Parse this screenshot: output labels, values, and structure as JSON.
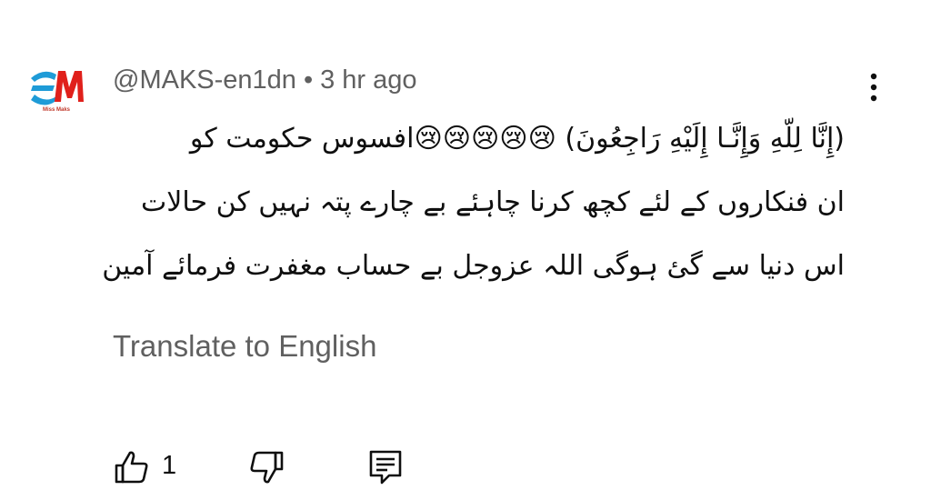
{
  "comment": {
    "author": "@MAKS-en1dn",
    "separator": "•",
    "time": "3 hr ago",
    "avatar": {
      "monogram": "M",
      "caption": "Miss Maks",
      "colors": {
        "background": "#ffffff",
        "cyan": "#1e9bd7",
        "red": "#e0201b",
        "caption": "#c0392b"
      }
    },
    "text": "(إِنَّا لِلّهِ وَإِنَّـا إِلَيْهِ رَاجِعُونَ) 😢😢😢😢😢افسوس حکومت کو\nان فنکاروں کے لئے کچھ کرنا چاہئے بے چارے پتہ نہیں کن حالات\nاس دنیا سے گئ ہوگی اللہ عزوجل بے حساب مغفرت فرمائے آمین",
    "translate_label": "Translate to English",
    "like_count": "1",
    "icons": {
      "more": "more-vert-icon",
      "like": "thumb-up-icon",
      "dislike": "thumb-down-icon",
      "reply": "reply-comment-icon"
    },
    "colors": {
      "text": "#0f0f0f",
      "secondary": "#606060",
      "background": "#ffffff"
    }
  }
}
